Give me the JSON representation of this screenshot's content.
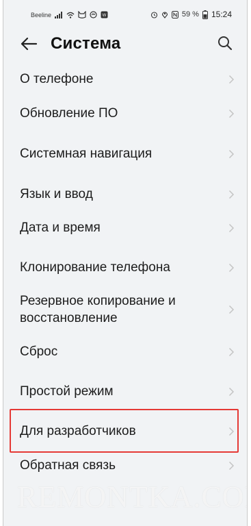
{
  "status_bar": {
    "carrier": "Beeline",
    "battery": "59 %",
    "time": "15:24"
  },
  "header": {
    "title": "Система"
  },
  "menu": {
    "items": [
      {
        "label": "О телефоне"
      },
      {
        "label": "Обновление ПО"
      },
      {
        "label": "Системная навигация"
      },
      {
        "label": "Язык и ввод"
      },
      {
        "label": "Дата и время"
      },
      {
        "label": "Клонирование телефона"
      },
      {
        "label": "Резервное копирование и",
        "label2": "восстановление"
      },
      {
        "label": "Сброс"
      },
      {
        "label": "Простой режим"
      },
      {
        "label": "Для разработчиков"
      },
      {
        "label": "Обратная связь"
      }
    ]
  },
  "highlight_color": "#e53935",
  "watermark": "REMONTKA.COM"
}
